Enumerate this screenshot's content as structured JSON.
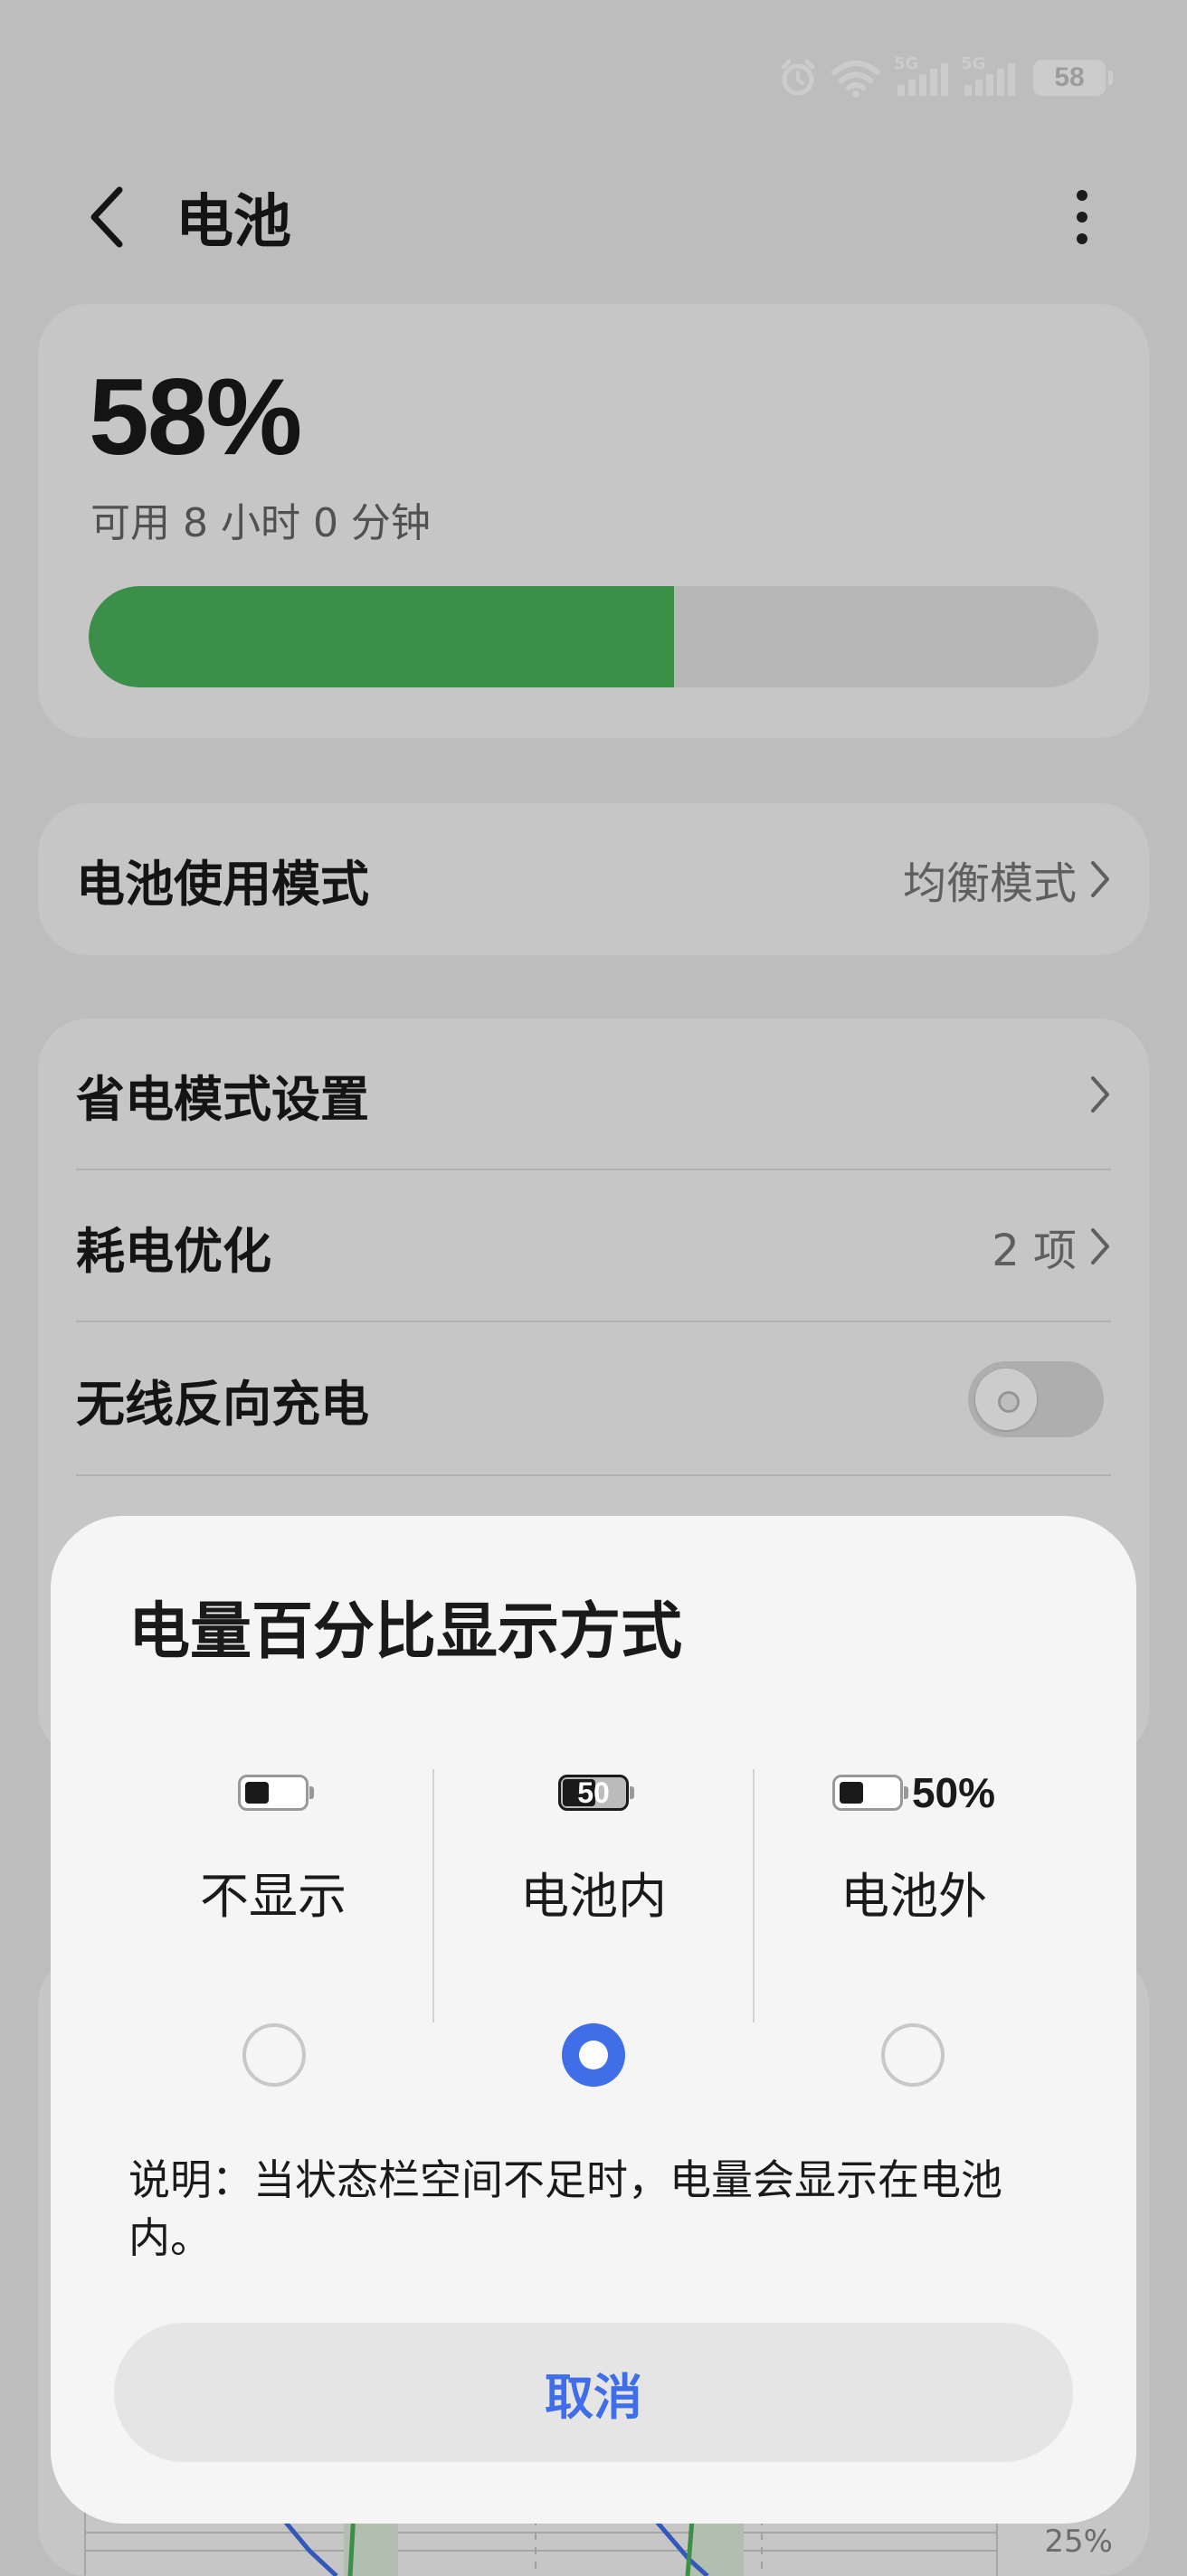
{
  "status_bar": {
    "signal1_tag": "5G",
    "signal2_tag": "5G",
    "battery_text": "58",
    "icons": [
      "alarm-icon",
      "wifi-icon",
      "signal-icon",
      "signal-icon",
      "battery-icon"
    ]
  },
  "header": {
    "title": "电池",
    "back_icon": "chevron-left-icon",
    "more_icon": "more-vertical-icon"
  },
  "battery_card": {
    "percent_text": "58%",
    "remaining": "可用 8 小时 0 分钟",
    "level_percent": 58,
    "fill_color": "#4bb35b"
  },
  "mode_card": {
    "label": "电池使用模式",
    "value": "均衡模式"
  },
  "settings": [
    {
      "label": "省电模式设置",
      "value": ""
    },
    {
      "label": "耗电优化",
      "value": "2 项"
    },
    {
      "label": "无线反向充电",
      "toggle": false
    }
  ],
  "chart": {
    "tick_label": "25%",
    "series_colors": [
      "#3f6ee8",
      "#4bb35b"
    ]
  },
  "dialog": {
    "title": "电量百分比显示方式",
    "options": [
      {
        "label": "不显示",
        "preview": "battery-no-percent-icon",
        "selected": false
      },
      {
        "label": "电池内",
        "preview": "battery-percent-inside-icon",
        "preview_text": "50",
        "selected": true
      },
      {
        "label": "电池外",
        "preview": "battery-percent-outside-icon",
        "preview_text": "50%",
        "selected": false
      }
    ],
    "note": "说明：当状态栏空间不足时，电量会显示在电池内。",
    "cancel_label": "取消",
    "accent_color": "#3f6ee8"
  }
}
